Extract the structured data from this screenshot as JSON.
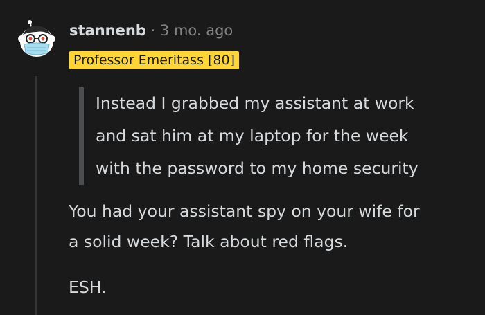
{
  "comment": {
    "author": "stannenb",
    "separator": "·",
    "timestamp": "3 mo. ago",
    "flair": "Professor Emeritass [80]",
    "avatar_icon": "snoo-with-mask-and-glasses-avatar",
    "quote_lines": [
      "Instead I grabbed my assistant at work",
      "and sat him at my laptop for the week",
      "with the password to my home security"
    ],
    "paragraphs": [
      {
        "lines": [
          "You had your assistant spy on your wife for",
          "a solid week? Talk about red flags."
        ]
      },
      {
        "lines": [
          "ESH."
        ]
      }
    ]
  },
  "colors": {
    "background": "#1a1a1b",
    "text": "#d7dadc",
    "meta_text": "#818384",
    "flair_bg": "#ffd635",
    "quote_bar": "#4b4d4f",
    "thread_line": "#343536"
  }
}
